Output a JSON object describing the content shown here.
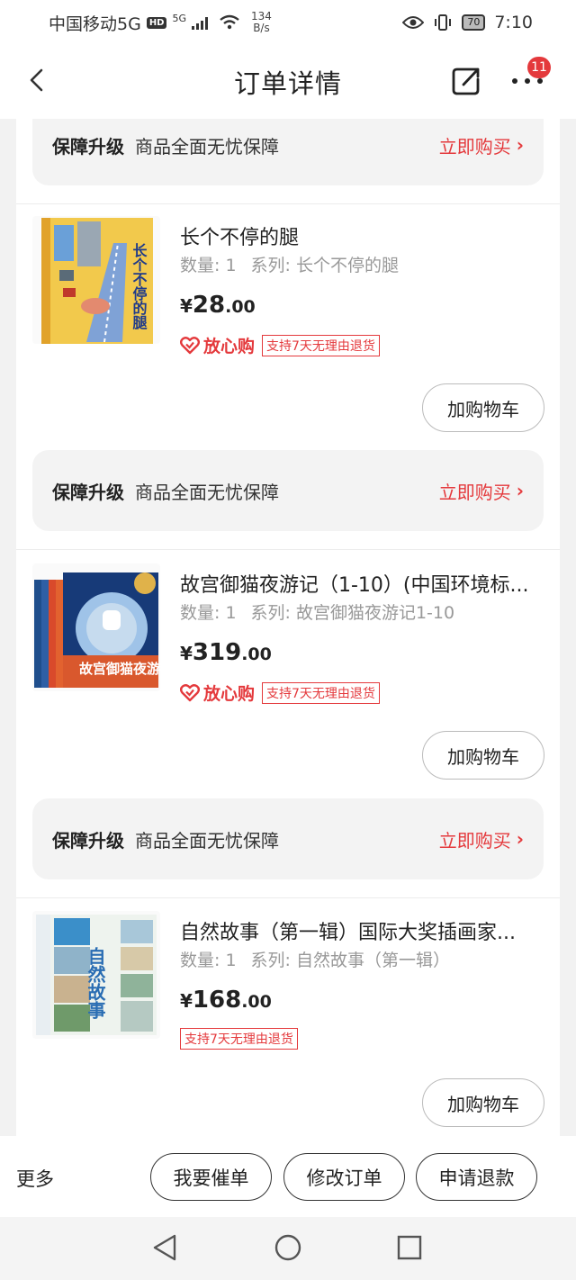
{
  "status_bar": {
    "carrier": "中国移动5G",
    "hd": "HD",
    "net_type": "5G",
    "speed_value": "134",
    "speed_unit": "B/s",
    "battery": "70",
    "time": "7:10"
  },
  "nav": {
    "title": "订单详情",
    "more_badge": "11"
  },
  "guarantee": {
    "title": "保障升级",
    "desc": "商品全面无忧保障",
    "buy": "立即购买"
  },
  "products": [
    {
      "name": "长个不停的腿",
      "qty_label": "数量: 1",
      "series_label": "系列: 长个不停的腿",
      "currency": "¥",
      "price_int": "28",
      "price_dec": ".00",
      "fxg": "放心购",
      "return_tag": "支持7天无理由退货",
      "cart": "加购物车"
    },
    {
      "name": "故宫御猫夜游记（1-10）(中国环境标...",
      "qty_label": "数量: 1",
      "series_label": "系列: 故宫御猫夜游记1-10",
      "currency": "¥",
      "price_int": "319",
      "price_dec": ".00",
      "fxg": "放心购",
      "return_tag": "支持7天无理由退货",
      "cart": "加购物车"
    },
    {
      "name": "自然故事（第一辑）国际大奖插画家...",
      "qty_label": "数量: 1",
      "series_label": "系列: 自然故事（第一辑）",
      "currency": "¥",
      "price_int": "168",
      "price_dec": ".00",
      "return_tag": "支持7天无理由退货",
      "cart": "加购物车"
    }
  ],
  "book_covers": {
    "book1_title": "长个不停的腿",
    "book2_title": "故宫御猫夜游记",
    "book3_title": "自然故事"
  },
  "bottom": {
    "more": "更多",
    "urge": "我要催单",
    "modify": "修改订单",
    "refund": "申请退款"
  },
  "colors": {
    "accent": "#e4393c",
    "background": "#f2f2f2"
  }
}
